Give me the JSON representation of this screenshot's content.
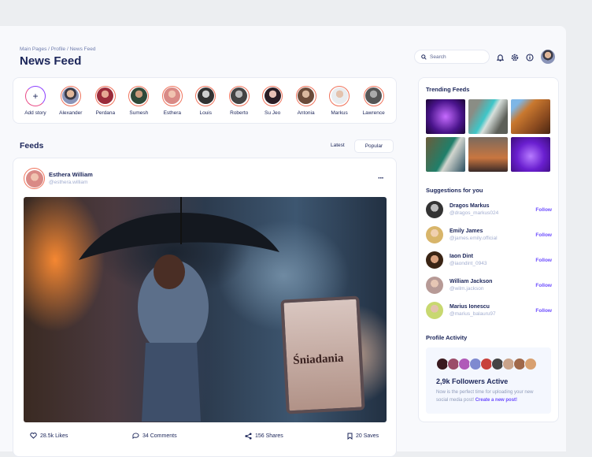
{
  "breadcrumb": "Main Pages / Profile / News Feed",
  "title": "News Feed",
  "search": {
    "placeholder": "Search"
  },
  "stories": {
    "add_label": "Add story",
    "items": [
      "Alexander",
      "Perdana",
      "Sumesh",
      "Esthera",
      "Louis",
      "Roberto",
      "Su Jeo",
      "Antonia",
      "Markus",
      "Lawrence"
    ]
  },
  "feeds": {
    "title": "Feeds",
    "tabs": [
      "Latest",
      "Popular"
    ]
  },
  "post": {
    "author": "Esthera William",
    "handle": "@esthera.william",
    "sign_text": "Śniadania",
    "likes": "28.5k Likes",
    "comments": "34 Comments",
    "shares": "156 Shares",
    "saves": "20 Saves"
  },
  "trending": {
    "title": "Trending Feeds"
  },
  "suggestions": {
    "title": "Suggestions for you",
    "follow_label": "Follow",
    "items": [
      {
        "name": "Dragos Markus",
        "handle": "@dragos_markus024"
      },
      {
        "name": "Emily James",
        "handle": "@james.emily.official"
      },
      {
        "name": "Iaon Dint",
        "handle": "@iaondint_0943"
      },
      {
        "name": "William Jackson",
        "handle": "@wilm.jackson"
      },
      {
        "name": "Marius Ionescu",
        "handle": "@marius_balauru97"
      }
    ]
  },
  "activity": {
    "title": "Profile Activity",
    "headline": "2,9k Followers Active",
    "text": "Now is the perfect time for uploading your new social media post!",
    "link": "Create a new post!"
  },
  "colors": {
    "accent": "#6c4cff",
    "navy": "#1b2559",
    "ring": "#f0725a"
  }
}
